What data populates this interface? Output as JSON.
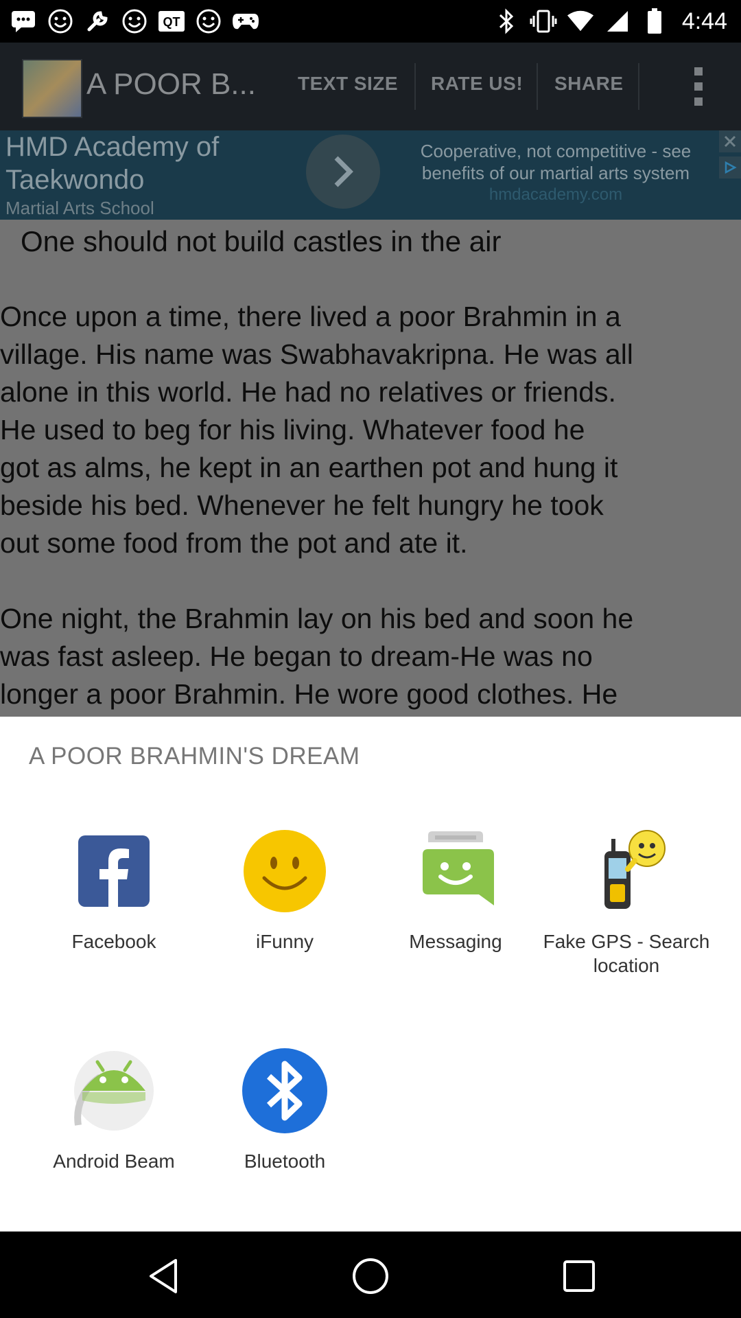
{
  "status_bar": {
    "time": "4:44",
    "left_icons": [
      "message-icon",
      "smiley-icon",
      "wrench-icon",
      "smiley-icon",
      "qt-icon",
      "smiley-icon",
      "game-controller-icon"
    ],
    "right_icons": [
      "bluetooth-icon",
      "vibrate-icon",
      "wifi-icon",
      "signal-icon",
      "battery-icon"
    ]
  },
  "app_bar": {
    "title": "A POOR B...",
    "actions": [
      "TEXT SIZE",
      "RATE US!",
      "SHARE"
    ],
    "overflow_icon": "more-vert-icon"
  },
  "ad": {
    "line1": "HMD Academy of",
    "line2": "Taekwondo",
    "line3": "Martial Arts School",
    "tagline": "Cooperative, not competitive - see benefits of our martial arts system",
    "url": "hmdacademy.com"
  },
  "story": {
    "title": "One should not build castles in the air",
    "para1": [
      "Once upon a time, there lived a poor Brahmin in a",
      "village. His name was Swabhavakripna. He was all",
      "alone in this world. He had no relatives or friends.",
      "He used to beg for his living. Whatever food he",
      "got as alms, he kept in an earthen pot and hung it",
      "beside his bed. Whenever he felt hungry he took",
      "out some food from the pot and ate it."
    ],
    "para2": [
      "One night, the Brahmin lay on his bed and soon he",
      "was fast asleep. He began to dream-He was no",
      "longer a poor Brahmin. He wore good clothes. He"
    ]
  },
  "share_sheet": {
    "heading": "A POOR BRAHMIN'S DREAM",
    "apps": [
      {
        "label": "Facebook",
        "icon": "facebook-icon"
      },
      {
        "label": "iFunny",
        "icon": "ifunny-icon"
      },
      {
        "label": "Messaging",
        "icon": "messaging-icon"
      },
      {
        "label": "Fake GPS - Search location",
        "icon": "fake-gps-icon"
      },
      {
        "label": "Android Beam",
        "icon": "android-beam-icon"
      },
      {
        "label": "Bluetooth",
        "icon": "bluetooth-icon"
      }
    ]
  },
  "nav_bar": {
    "buttons": [
      "back-icon",
      "home-icon",
      "recents-icon"
    ]
  },
  "colors": {
    "facebook": "#3b5998",
    "ifunny": "#f7c600",
    "messaging": "#8bc34a",
    "bluetooth": "#1e6fd9",
    "android": "#8bc34a",
    "scrim": "#737373"
  }
}
